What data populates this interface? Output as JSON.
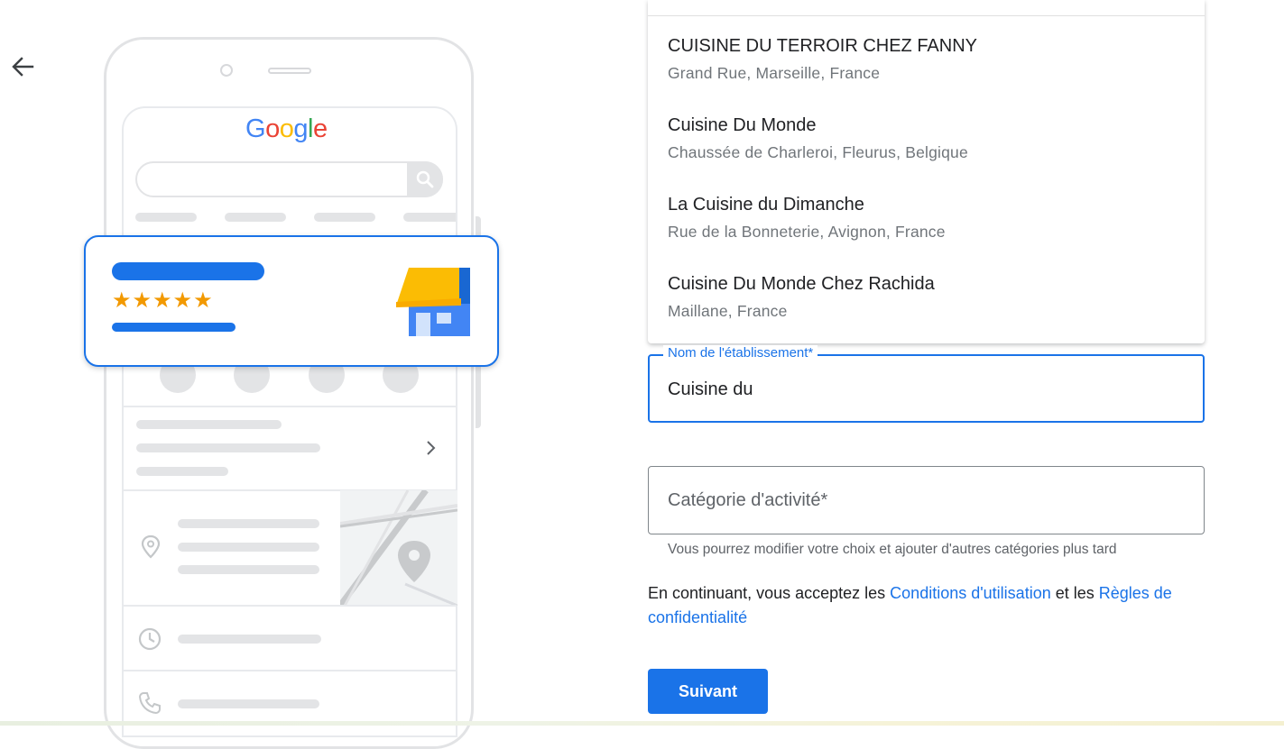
{
  "nav": {
    "back_icon": "arrow-back-icon"
  },
  "illustration": {
    "logo_text": "Google",
    "logo_colors": [
      "#4285f4",
      "#ea4335",
      "#fbbc05",
      "#4285f4",
      "#34a853",
      "#ea4335"
    ],
    "stars_text": "★★★★★",
    "rating": 5,
    "accent": "#1a73e8",
    "star_color": "#f29900"
  },
  "suggestions": [
    {
      "title": "CUISINE DU TERROIR CHEZ FANNY",
      "subtitle": "Grand Rue, Marseille, France"
    },
    {
      "title": "Cuisine Du Monde",
      "subtitle": "Chaussée de Charleroi, Fleurus, Belgique"
    },
    {
      "title": "La Cuisine du Dimanche",
      "subtitle": "Rue de la Bonneterie, Avignon, France"
    },
    {
      "title": "Cuisine Du Monde Chez Rachida",
      "subtitle": "Maillane, France"
    }
  ],
  "form": {
    "business_name_label": "Nom de l'établissement*",
    "business_name_value": "Cuisine du",
    "category_placeholder": "Catégorie d'activité*",
    "category_helper": "Vous pourrez modifier votre choix et ajouter d'autres catégories plus tard",
    "terms_prefix": "En continuant, vous acceptez les ",
    "terms_link": "Conditions d'utilisation",
    "terms_middle": " et les ",
    "privacy_link": "Règles de confidentialité",
    "next_label": "Suivant"
  },
  "colors": {
    "primary": "#1a73e8",
    "text": "#202124",
    "secondary_text": "#70757a"
  }
}
